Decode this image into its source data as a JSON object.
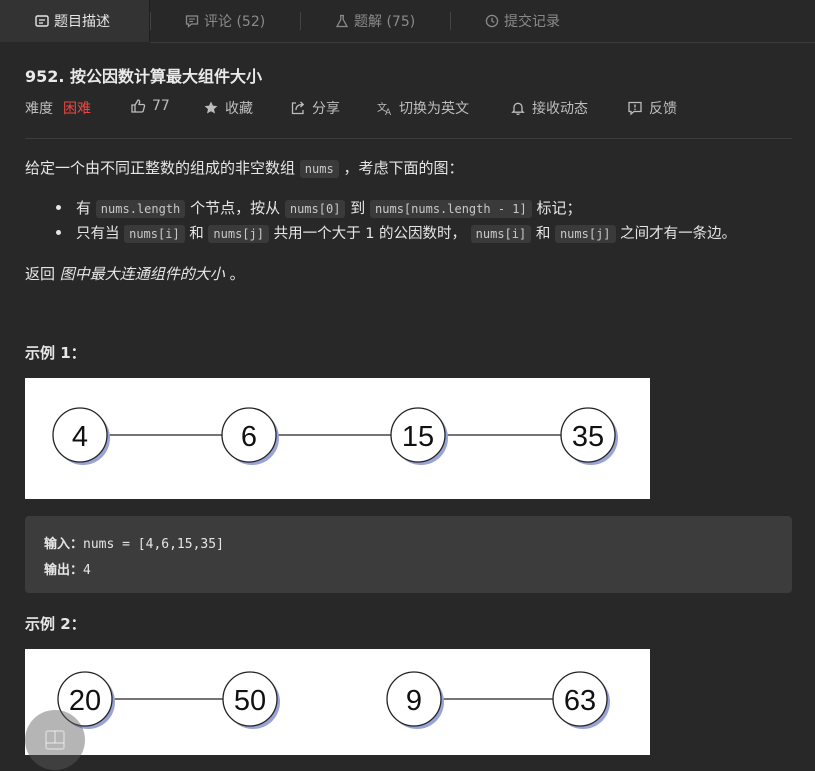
{
  "tabs": [
    {
      "label": "题目描述",
      "icon": "description-icon"
    },
    {
      "label": "评论 (52)",
      "icon": "comment-icon"
    },
    {
      "label": "题解 (75)",
      "icon": "flask-icon"
    },
    {
      "label": "提交记录",
      "icon": "clock-icon"
    }
  ],
  "problem": {
    "title": "952. 按公因数计算最大组件大小",
    "difficulty_label": "难度",
    "difficulty": "困难",
    "likes": "77",
    "favorite": "收藏",
    "share": "分享",
    "switch_lang": "切换为英文",
    "subscribe": "接收动态",
    "feedback": "反馈"
  },
  "desc": {
    "p1_a": "给定一个由不同正整数的组成的非空数组",
    "p1_code": "nums",
    "p1_b": "，考虑下面的图：",
    "li1_a": "有",
    "li1_code1": "nums.length",
    "li1_b": "个节点，按从",
    "li1_code2": "nums[0]",
    "li1_c": "到",
    "li1_code3": "nums[nums.length - 1]",
    "li1_d": "标记；",
    "li2_a": "只有当",
    "li2_code1": "nums[i]",
    "li2_b": "和",
    "li2_code2": "nums[j]",
    "li2_c": "共用一个大于 1 的公因数时，",
    "li2_code3": "nums[i]",
    "li2_d": "和",
    "li2_code4": "nums[j]",
    "li2_e": "之间才有一条边。",
    "p2_a": "返回",
    "p2_em": "图中最大连通组件的大小",
    "p2_b": "。"
  },
  "example1": {
    "heading": "示例 1：",
    "nodes": [
      "4",
      "6",
      "15",
      "35"
    ],
    "input_label": "输入：",
    "input": "nums = [4,6,15,35]",
    "output_label": "输出：",
    "output": "4"
  },
  "example2": {
    "heading": "示例 2：",
    "nodes": [
      "20",
      "50",
      "9",
      "63"
    ]
  },
  "colors": {
    "background": "#282828",
    "hard": "#ef4743",
    "code_bg": "#3a3a3a"
  }
}
